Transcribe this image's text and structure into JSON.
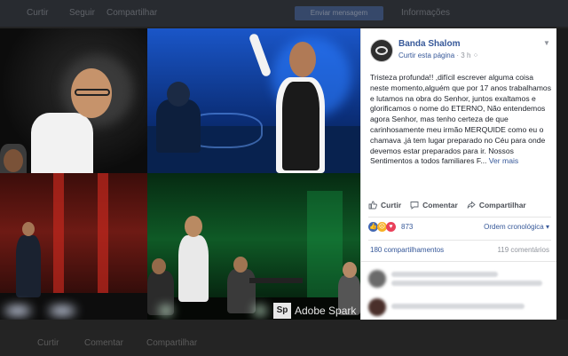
{
  "background": {
    "topbar_items": [
      "Curtir",
      "Seguir",
      "Compartilhar"
    ],
    "topbar_button": "Enviar mensagem",
    "topbar_right": "Informações",
    "bottombar_items": [
      "Curtir",
      "Comentar",
      "Compartilhar"
    ]
  },
  "photo": {
    "watermark_mark": "Sp",
    "watermark_text": "Adobe Spark"
  },
  "post": {
    "page_name": "Banda Shalom",
    "follow_link": "Curtir esta página",
    "time": "3 h",
    "text": "Tristeza profunda!! ,difícil escrever alguma coisa neste momento,alguém que por 17 anos trabalhamos e lutamos na obra do Senhor, juntos exaltamos e glorificamos o nome do ETERNO, Não entendemos agora Senhor, mas tenho certeza de que carinhosamente meu irmão MERQUIDE como eu o chamava ,já tem lugar preparado no Céu para onde devemos estar preparados para ir. Nossos Sentimentos a todos familiares F...",
    "see_more": "Ver mais",
    "actions": {
      "like": "Curtir",
      "comment": "Comentar",
      "share": "Compartilhar"
    },
    "reactions_count": "873",
    "order": "Ordem cronológica",
    "shares": "180 compartilhamentos",
    "comments": "119 comentários"
  },
  "colors": {
    "link": "#365899",
    "like_blue": "#4267b2",
    "love_red": "#e9405a",
    "sad_yellow": "#f7b125"
  },
  "icons": [
    "like-icon",
    "comment-icon",
    "share-icon",
    "chevron-down-icon"
  ]
}
